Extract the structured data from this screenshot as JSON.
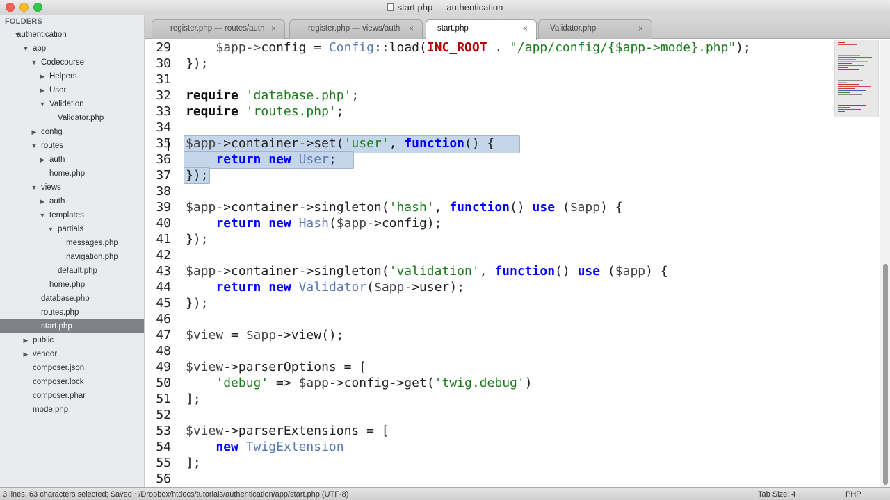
{
  "window": {
    "title": "start.php — authentication"
  },
  "sidebar": {
    "header": "FOLDERS",
    "items": [
      {
        "label": "authentication",
        "level": 0,
        "arrow": "down"
      },
      {
        "label": "app",
        "level": 1,
        "arrow": "down"
      },
      {
        "label": "Codecourse",
        "level": 2,
        "arrow": "down"
      },
      {
        "label": "Helpers",
        "level": 3,
        "arrow": "right"
      },
      {
        "label": "User",
        "level": 3,
        "arrow": "right"
      },
      {
        "label": "Validation",
        "level": 3,
        "arrow": "down"
      },
      {
        "label": "Validator.php",
        "level": 4,
        "arrow": ""
      },
      {
        "label": "config",
        "level": 2,
        "arrow": "right"
      },
      {
        "label": "routes",
        "level": 2,
        "arrow": "down"
      },
      {
        "label": "auth",
        "level": 3,
        "arrow": "right"
      },
      {
        "label": "home.php",
        "level": 3,
        "arrow": ""
      },
      {
        "label": "views",
        "level": 2,
        "arrow": "down"
      },
      {
        "label": "auth",
        "level": 3,
        "arrow": "right"
      },
      {
        "label": "templates",
        "level": 3,
        "arrow": "down"
      },
      {
        "label": "partials",
        "level": 4,
        "arrow": "down"
      },
      {
        "label": "messages.php",
        "level": 5,
        "arrow": ""
      },
      {
        "label": "navigation.php",
        "level": 5,
        "arrow": ""
      },
      {
        "label": "default.php",
        "level": 4,
        "arrow": ""
      },
      {
        "label": "home.php",
        "level": 3,
        "arrow": ""
      },
      {
        "label": "database.php",
        "level": 2,
        "arrow": ""
      },
      {
        "label": "routes.php",
        "level": 2,
        "arrow": ""
      },
      {
        "label": "start.php",
        "level": 2,
        "arrow": "",
        "selected": true
      },
      {
        "label": "public",
        "level": 1,
        "arrow": "right"
      },
      {
        "label": "vendor",
        "level": 1,
        "arrow": "right"
      },
      {
        "label": "composer.json",
        "level": 1,
        "arrow": ""
      },
      {
        "label": "composer.lock",
        "level": 1,
        "arrow": ""
      },
      {
        "label": "composer.phar",
        "level": 1,
        "arrow": ""
      },
      {
        "label": "mode.php",
        "level": 1,
        "arrow": ""
      }
    ]
  },
  "tabs": [
    {
      "label": "register.php — routes/auth",
      "close": "×",
      "active": false
    },
    {
      "label": "register.php — views/auth",
      "close": "×",
      "active": false
    },
    {
      "label": "start.php",
      "close": "×",
      "active": true
    },
    {
      "label": "Validator.php",
      "close": "×",
      "active": false
    }
  ],
  "editor": {
    "lines": [
      {
        "n": "29",
        "segs": [
          [
            "    ",
            ""
          ],
          [
            "$app",
            "var"
          ],
          [
            "->",
            "fn"
          ],
          [
            "config = ",
            ""
          ],
          [
            "Config",
            "cls"
          ],
          [
            "::load(",
            ""
          ],
          [
            "INC_ROOT",
            "const"
          ],
          [
            " . ",
            ""
          ],
          [
            "\"/app/config/{$app->mode}.php\"",
            "str"
          ],
          [
            ");",
            ""
          ]
        ]
      },
      {
        "n": "30",
        "segs": [
          [
            "});",
            ""
          ]
        ]
      },
      {
        "n": "31",
        "segs": []
      },
      {
        "n": "32",
        "segs": [
          [
            "require",
            "kw2"
          ],
          [
            " ",
            ""
          ],
          [
            "'database.php'",
            "str"
          ],
          [
            ";",
            ""
          ]
        ]
      },
      {
        "n": "33",
        "segs": [
          [
            "require",
            "kw2"
          ],
          [
            " ",
            ""
          ],
          [
            "'routes.php'",
            "str"
          ],
          [
            ";",
            ""
          ]
        ]
      },
      {
        "n": "34",
        "segs": []
      },
      {
        "n": "35",
        "segs": [
          [
            "$app",
            "var"
          ],
          [
            "->container->set(",
            ""
          ],
          [
            "'user'",
            "str"
          ],
          [
            ", ",
            ""
          ],
          [
            "function",
            "kw"
          ],
          [
            "() {",
            ""
          ]
        ]
      },
      {
        "n": "36",
        "segs": [
          [
            "    ",
            ""
          ],
          [
            "return",
            "kw"
          ],
          [
            " ",
            ""
          ],
          [
            "new",
            "kw"
          ],
          [
            " ",
            ""
          ],
          [
            "User",
            "cls"
          ],
          [
            ";",
            ""
          ]
        ]
      },
      {
        "n": "37",
        "segs": [
          [
            "});",
            ""
          ]
        ]
      },
      {
        "n": "38",
        "segs": []
      },
      {
        "n": "39",
        "segs": [
          [
            "$app",
            "var"
          ],
          [
            "->container->singleton(",
            ""
          ],
          [
            "'hash'",
            "str"
          ],
          [
            ", ",
            ""
          ],
          [
            "function",
            "kw"
          ],
          [
            "() ",
            ""
          ],
          [
            "use",
            "kw"
          ],
          [
            " (",
            ""
          ],
          [
            "$app",
            "var"
          ],
          [
            ") {",
            ""
          ]
        ]
      },
      {
        "n": "40",
        "segs": [
          [
            "    ",
            ""
          ],
          [
            "return",
            "kw"
          ],
          [
            " ",
            ""
          ],
          [
            "new",
            "kw"
          ],
          [
            " ",
            ""
          ],
          [
            "Hash",
            "cls"
          ],
          [
            "(",
            ""
          ],
          [
            "$app",
            "var"
          ],
          [
            "->config);",
            ""
          ]
        ]
      },
      {
        "n": "41",
        "segs": [
          [
            "});",
            ""
          ]
        ]
      },
      {
        "n": "42",
        "segs": []
      },
      {
        "n": "43",
        "segs": [
          [
            "$app",
            "var"
          ],
          [
            "->container->singleton(",
            ""
          ],
          [
            "'validation'",
            "str"
          ],
          [
            ", ",
            ""
          ],
          [
            "function",
            "kw"
          ],
          [
            "() ",
            ""
          ],
          [
            "use",
            "kw"
          ],
          [
            " (",
            ""
          ],
          [
            "$app",
            "var"
          ],
          [
            ") {",
            ""
          ]
        ]
      },
      {
        "n": "44",
        "segs": [
          [
            "    ",
            ""
          ],
          [
            "return",
            "kw"
          ],
          [
            " ",
            ""
          ],
          [
            "new",
            "kw"
          ],
          [
            " ",
            ""
          ],
          [
            "Validator",
            "cls"
          ],
          [
            "(",
            ""
          ],
          [
            "$app",
            "var"
          ],
          [
            "->user);",
            ""
          ]
        ]
      },
      {
        "n": "45",
        "segs": [
          [
            "});",
            ""
          ]
        ]
      },
      {
        "n": "46",
        "segs": []
      },
      {
        "n": "47",
        "segs": [
          [
            "$view",
            "var"
          ],
          [
            " = ",
            ""
          ],
          [
            "$app",
            "var"
          ],
          [
            "->view();",
            ""
          ]
        ]
      },
      {
        "n": "48",
        "segs": []
      },
      {
        "n": "49",
        "segs": [
          [
            "$view",
            "var"
          ],
          [
            "->parserOptions = [",
            ""
          ]
        ]
      },
      {
        "n": "50",
        "segs": [
          [
            "    ",
            ""
          ],
          [
            "'debug'",
            "str"
          ],
          [
            " => ",
            ""
          ],
          [
            "$app",
            "var"
          ],
          [
            "->config->get(",
            ""
          ],
          [
            "'twig.debug'",
            "str"
          ],
          [
            ")",
            ""
          ]
        ]
      },
      {
        "n": "51",
        "segs": [
          [
            "];",
            ""
          ]
        ]
      },
      {
        "n": "52",
        "segs": []
      },
      {
        "n": "53",
        "segs": [
          [
            "$view",
            "var"
          ],
          [
            "->parserExtensions = [",
            ""
          ]
        ]
      },
      {
        "n": "54",
        "segs": [
          [
            "    ",
            ""
          ],
          [
            "new",
            "kw"
          ],
          [
            " ",
            ""
          ],
          [
            "TwigExtension",
            "cls"
          ]
        ]
      },
      {
        "n": "55",
        "segs": [
          [
            "];",
            ""
          ]
        ]
      },
      {
        "n": "56",
        "segs": []
      }
    ]
  },
  "status": {
    "left": "3 lines, 63 characters selected; Saved ~/Dropbox/htdocs/tutorials/authentication/app/start.php (UTF-8)",
    "tab_size": "Tab Size: 4",
    "syntax": "PHP"
  },
  "colors": {
    "keyword": "#0000ff",
    "string": "#1c7b1c",
    "class": "#5a7ab3",
    "constant": "#b30000",
    "selection": "#c5d5ea",
    "sidebar_selected": "#7e8286"
  }
}
